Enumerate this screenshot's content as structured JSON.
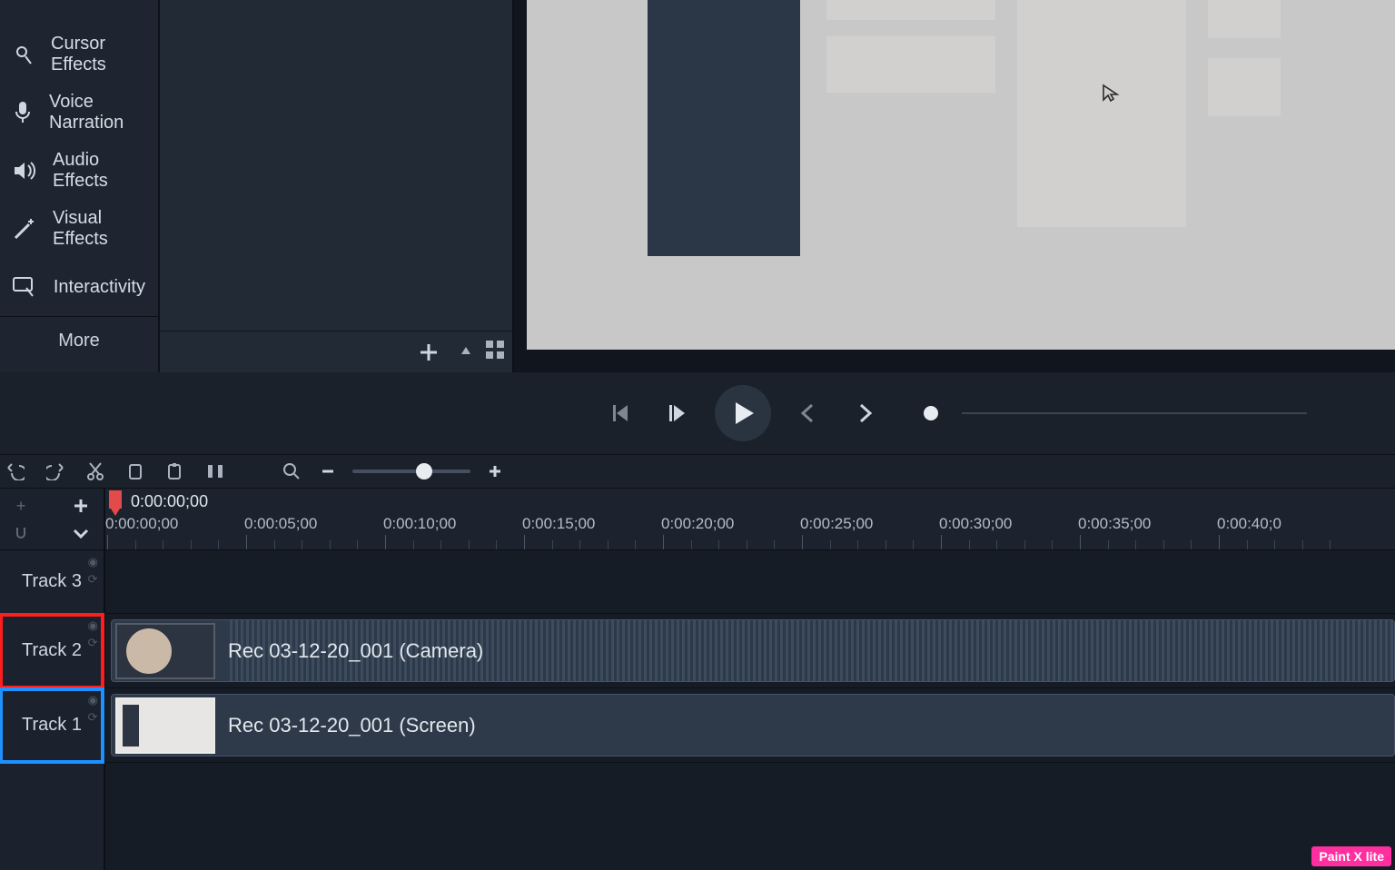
{
  "sidebar": {
    "items": [
      {
        "label": ""
      },
      {
        "label": "Cursor Effects"
      },
      {
        "label": "Voice Narration"
      },
      {
        "label": "Audio Effects"
      },
      {
        "label": "Visual Effects"
      },
      {
        "label": "Interactivity"
      }
    ],
    "more_label": "More"
  },
  "playback": {
    "playhead_time": "0:00:00;00"
  },
  "ruler": {
    "labels": [
      "0:00:00;00",
      "0:00:05;00",
      "0:00:10;00",
      "0:00:15;00",
      "0:00:20;00",
      "0:00:25;00",
      "0:00:30;00",
      "0:00:35;00",
      "0:00:40;0"
    ]
  },
  "tracks": {
    "t3": {
      "name": "Track 3"
    },
    "t2": {
      "name": "Track 2",
      "highlight": "red",
      "clip_label": "Rec 03-12-20_001 (Camera)"
    },
    "t1": {
      "name": "Track 1",
      "highlight": "blue",
      "clip_label": "Rec 03-12-20_001 (Screen)"
    }
  },
  "watermark": "Paint X lite"
}
